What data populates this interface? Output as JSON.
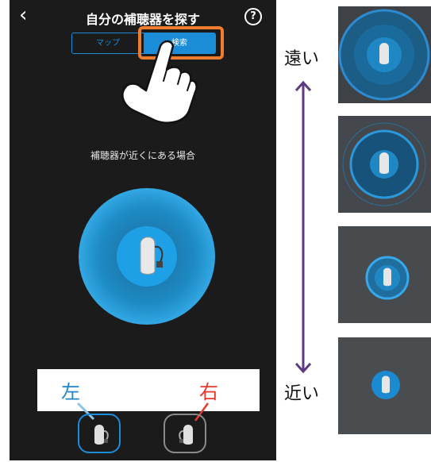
{
  "header": {
    "back_glyph": "‹",
    "title": "自分の補聴器を探す",
    "help_glyph": "?"
  },
  "tabs": {
    "map_label": "マップ",
    "search_label": "検索",
    "selected": "search",
    "selected_color": "#1a8cd8",
    "highlight_color": "#ef7d2d"
  },
  "main": {
    "subtitle": "補聴器が近くにある場合"
  },
  "devices": {
    "left_label": "左",
    "right_label": "右",
    "left_color": "#1f86c8",
    "right_color": "#e53a2a"
  },
  "proximity_legend": {
    "far_label": "遠い",
    "near_label": "近い",
    "arrow_color": "#5b3a82",
    "steps": [
      "far",
      "mid-far",
      "mid-near",
      "near"
    ]
  },
  "icons": {
    "back": "chevron-left-icon",
    "help": "question-circle-icon",
    "hand": "pointing-hand-icon",
    "device": "hearing-aid-icon"
  }
}
